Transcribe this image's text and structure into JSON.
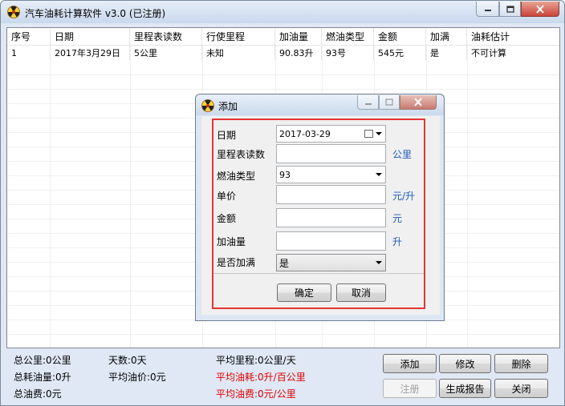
{
  "window": {
    "title": "汽车油耗计算软件 v3.0 (已注册)"
  },
  "table": {
    "headers": [
      "序号",
      "日期",
      "里程表读数",
      "行使里程",
      "加油量",
      "燃油类型",
      "金额",
      "加满",
      "油耗估计"
    ],
    "rows": [
      [
        "1",
        "2017年3月29日",
        "5公里",
        "未知",
        "90.83升",
        "93号",
        "545元",
        "是",
        "不可计算"
      ]
    ]
  },
  "stats": {
    "total_km": "总公里:0公里",
    "total_fuel": "总耗油量:0升",
    "total_cost": "总油费:0元",
    "days": "天数:0天",
    "avg_price": "平均油价:0元",
    "avg_mileage": "平均里程:0公里/天",
    "avg_consumption": "平均油耗:0升/百公里",
    "avg_cost": "平均油费:0元/公里"
  },
  "buttons": {
    "add": "添加",
    "edit": "修改",
    "delete": "删除",
    "register": "注册",
    "report": "生成报告",
    "close": "关闭"
  },
  "dialog": {
    "title": "添加",
    "date_label": "日期",
    "date_value": "2017-03-29",
    "odometer_label": "里程表读数",
    "odometer_unit": "公里",
    "fuel_type_label": "燃油类型",
    "fuel_type_value": "93",
    "price_label": "单价",
    "price_unit": "元/升",
    "amount_label": "金额",
    "amount_unit": "元",
    "volume_label": "加油量",
    "volume_unit": "升",
    "full_label": "是否加满",
    "full_value": "是",
    "ok": "确定",
    "cancel": "取消"
  },
  "colors": {
    "highlight_frame": "#e53535",
    "warning_text": "#e00000",
    "unit_text": "#1e5bb8"
  }
}
